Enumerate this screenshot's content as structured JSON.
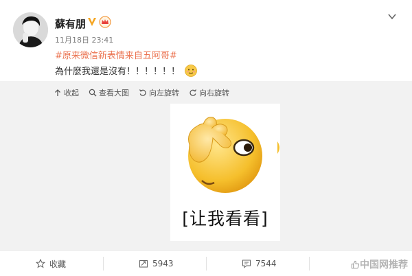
{
  "post": {
    "username": "蘇有朋",
    "timestamp": "11月18日 23:41",
    "topic": "#原来微信新表情来自五阿哥#",
    "content": "為什麼我還是沒有！！！！！！"
  },
  "media_toolbar": {
    "collapse": "收起",
    "view_large": "查看大图",
    "rotate_left": "向左旋转",
    "rotate_right": "向右旋转"
  },
  "sticker": {
    "caption": "[让我看看]"
  },
  "actions": {
    "favorite": "收藏",
    "repost_count": "5943",
    "comment_count": "7544"
  },
  "watermark": {
    "text": "中国网推荐"
  },
  "colors": {
    "topic": "#eb7350",
    "v_badge": "#f5a623",
    "emoji_face": "#f7c948"
  },
  "icons": [
    "v-verified-icon",
    "crown-icon",
    "chevron-down-icon",
    "shy-emoji-icon",
    "collapse-arrow-icon",
    "search-icon",
    "rotate-left-icon",
    "rotate-right-icon",
    "star-icon",
    "repost-icon",
    "comment-icon",
    "thumb-icon"
  ]
}
